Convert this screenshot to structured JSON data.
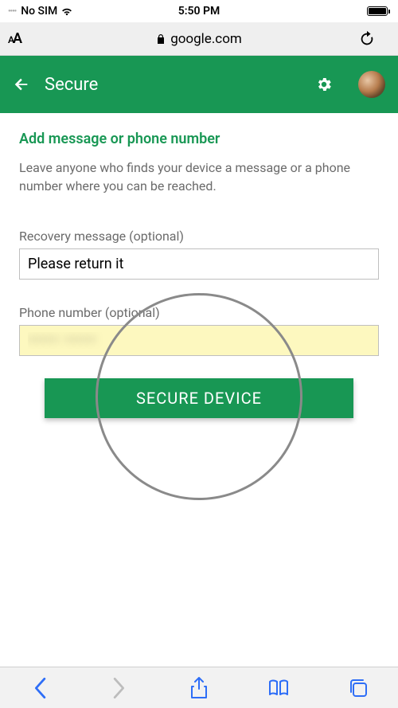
{
  "status": {
    "carrier": "No SIM",
    "time": "5:50 PM"
  },
  "browser": {
    "url": "google.com"
  },
  "header": {
    "title": "Secure"
  },
  "content": {
    "section_title": "Add message or phone number",
    "section_desc": "Leave anyone who finds your device a message or a phone number where you can be reached.",
    "recovery_label": "Recovery message (optional)",
    "recovery_value": "Please return it",
    "phone_label": "Phone number (optional)",
    "phone_value": "••••• •••••",
    "button_label": "SECURE DEVICE"
  }
}
